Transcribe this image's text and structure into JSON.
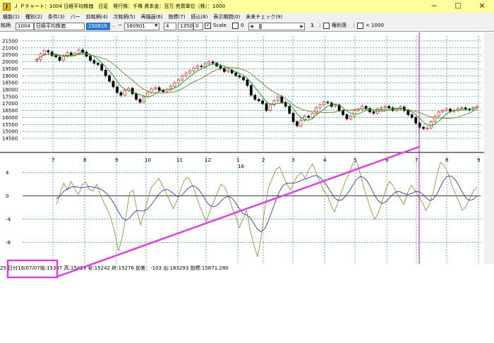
{
  "window": {
    "title": "Ｊ Ｐチャート：1004 日経平均株価　日足　発行株：千株 資本金：百万 売買単位（株）：1000",
    "icon_label": "J",
    "minimize": "─",
    "maximize": "☐",
    "close": "✕"
  },
  "menu": {
    "items": [
      "機能(1)",
      "種別(2)",
      "条件(3)",
      "バー",
      "前銘柄(4)",
      "次銘柄(5)",
      "再描画(6)",
      "指標(7)",
      "読込(8)",
      "表示期間(0)",
      "未来チェック(9)"
    ]
  },
  "toolbar": {
    "code_label": "銘柄",
    "code_value": "1004",
    "name_value": "日経平均株価",
    "date_selected": "150819",
    "date_from": "160901",
    "period": "4",
    "span": "1350",
    "zero": "0",
    "scale_label": "Scale",
    "scale_checked": "✓",
    "opt_zero_label": "0",
    "counter": "1",
    "rights_label": "権利落",
    "times_label": "× 1000"
  },
  "chart_data": [
    {
      "type": "candlestick",
      "title": "",
      "y_ticks": [
        14500,
        15000,
        15500,
        16000,
        16500,
        17000,
        17500,
        18000,
        18500,
        19000,
        19500,
        20000,
        20500,
        21000,
        21500
      ],
      "ylim": [
        14300,
        21600
      ],
      "x_month_labels": [
        "7",
        "8",
        "9",
        "10",
        "11",
        "12",
        "1",
        "2",
        "3",
        "4",
        "5",
        "6",
        "7",
        "8",
        "9"
      ],
      "x_year_label": "16",
      "series": [
        {
          "name": "",
          "close": [
            20150,
            20550,
            20800,
            20700,
            20450,
            20350,
            20100,
            20400,
            20650,
            20500,
            20600,
            20850,
            20700,
            20400,
            20100,
            19900,
            19800,
            19400,
            19000,
            18600,
            18200,
            17800,
            17600,
            17950,
            18100,
            17700,
            17300,
            17100,
            17500,
            17800,
            18050,
            18150,
            17950,
            17850,
            18000,
            18250,
            18500,
            18700,
            19000,
            19200,
            19350,
            19550,
            19700,
            19650,
            19850,
            20000,
            19900,
            19700,
            19500,
            19300,
            19400,
            19200,
            19000,
            18900,
            18700,
            18300,
            17600,
            17300,
            17200,
            17000,
            16500,
            16900,
            17200,
            17500,
            17100,
            16800,
            16300,
            15700,
            15400,
            15800,
            16100,
            16000,
            16300,
            16700,
            16900,
            17100,
            17050,
            16800,
            16900,
            16500,
            16200,
            15900,
            16100,
            16500,
            16600,
            16800,
            16650,
            16400,
            16300,
            16600,
            16700,
            16800,
            16700,
            16500,
            16600,
            16750,
            16500,
            16200,
            16000,
            15600,
            15300,
            15200,
            15250,
            15700,
            16100,
            16400,
            16500,
            16600,
            16450,
            16500,
            16650,
            16700,
            16600,
            16550,
            16700,
            16800
          ]
        },
        {
          "name": "",
          "ma": "short"
        },
        {
          "name": "",
          "ma": "long"
        }
      ]
    },
    {
      "type": "line",
      "title": "",
      "y_ticks": [
        4,
        0,
        -4,
        -8
      ],
      "ylim": [
        -11,
        6.5
      ],
      "series": [
        {
          "name": "",
          "values": [
            -1.5,
            0.5,
            2.2,
            1.0,
            2.5,
            1.2,
            0.2,
            1.8,
            2.4,
            1.1,
            0.8,
            2.0,
            0.3,
            -1.2,
            -2.5,
            -4.0,
            -6.5,
            -9.5,
            -7.0,
            -3.5,
            0.5,
            1.0,
            -2.5,
            -5.0,
            -3.0,
            -0.5,
            1.5,
            2.2,
            3.0,
            1.8,
            0.5,
            -1.0,
            -2.2,
            -0.8,
            1.2,
            2.8,
            3.2,
            2.0,
            0.5,
            -1.5,
            -3.0,
            -4.5,
            -2.5,
            -1.0,
            0.5,
            2.0,
            1.5,
            0.0,
            -2.0,
            -3.5,
            -5.5,
            -4.0,
            -2.5,
            -6.0,
            -8.5,
            -10.5,
            -7.0,
            -2.0,
            1.5,
            3.0,
            4.5,
            5.0,
            3.5,
            2.0,
            1.0,
            2.5,
            3.5,
            4.0,
            3.0,
            4.5,
            5.5,
            4.0,
            2.5,
            1.0,
            0.2,
            -1.5,
            -2.8,
            -1.0,
            0.8,
            2.5,
            3.8,
            5.5,
            6.0,
            4.0,
            1.5,
            -0.5,
            -2.5,
            -4.0,
            -3.0,
            -1.0,
            1.0,
            2.5,
            1.8,
            0.5,
            -0.5,
            -1.5,
            0.5,
            1.8,
            1.0,
            -0.2,
            -1.0,
            -2.5,
            -1.5,
            0.5,
            3.5,
            5.8,
            5.2,
            4.0,
            2.0,
            0.5,
            -1.0,
            -2.5,
            -1.8,
            -0.5,
            0.8,
            1.5
          ]
        },
        {
          "name": "",
          "values": [
            -0.5,
            0.0,
            0.8,
            1.2,
            1.5,
            1.6,
            1.5,
            1.4,
            1.5,
            1.6,
            1.5,
            1.4,
            1.2,
            0.8,
            0.2,
            -0.6,
            -1.6,
            -2.8,
            -3.8,
            -4.2,
            -3.8,
            -3.0,
            -2.5,
            -2.6,
            -2.6,
            -2.2,
            -1.5,
            -0.6,
            0.3,
            0.9,
            1.1,
            0.9,
            0.4,
            -0.1,
            0.0,
            0.6,
            1.3,
            1.7,
            1.6,
            1.0,
            0.1,
            -1.0,
            -1.7,
            -1.9,
            -1.6,
            -0.9,
            -0.3,
            -0.1,
            -0.4,
            -1.2,
            -2.2,
            -3.0,
            -3.3,
            -3.8,
            -4.8,
            -5.8,
            -6.2,
            -5.6,
            -4.2,
            -2.5,
            -0.7,
            0.8,
            1.8,
            2.2,
            2.2,
            2.2,
            2.4,
            2.7,
            2.9,
            3.1,
            3.4,
            3.5,
            3.2,
            2.6,
            1.7,
            0.7,
            -0.3,
            -0.8,
            -0.7,
            -0.1,
            0.8,
            1.8,
            2.8,
            3.3,
            3.2,
            2.5,
            1.4,
            0.1,
            -0.9,
            -1.3,
            -1.1,
            -0.4,
            0.3,
            0.7,
            0.7,
            0.4,
            0.2,
            0.4,
            0.7,
            0.7,
            0.4,
            -0.3,
            -0.8,
            -0.6,
            0.3,
            1.6,
            2.8,
            3.4,
            3.4,
            2.8,
            1.8,
            0.6,
            -0.4,
            -0.8,
            -0.6,
            0.0
          ]
        }
      ]
    }
  ],
  "status": {
    "prefix": "25",
    "date": ":日付16/07/07",
    "rest": "始:15347 高:15419 安:15242 終:15276 前差：-103 出:183293 指標:15871.280"
  },
  "colors": {
    "titlebar_bg": "#ffff9c",
    "up_candle": "#ff0000",
    "down_candle": "#000000",
    "ma_short": "#00a000",
    "ma_long": "#7a7a20",
    "grid": "#008080",
    "cursor": "#cc00cc",
    "osc_main": "#8a8a20",
    "osc_signal": "#2020c0",
    "highlight_box": "#e040e0"
  }
}
